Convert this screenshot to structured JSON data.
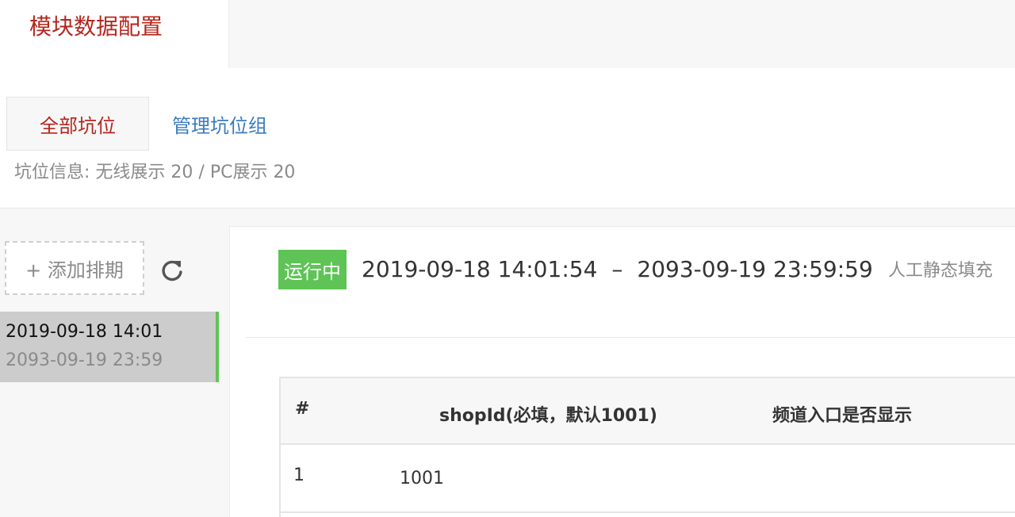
{
  "header": {
    "module_title": "模块数据配置"
  },
  "tabs": [
    {
      "label": "全部坑位",
      "active": true
    },
    {
      "label": "管理坑位组",
      "active": false
    }
  ],
  "slot_info": {
    "label": "坑位信息: ",
    "wireless_label": "无线展示 ",
    "wireless_count": "20",
    "separator": " / ",
    "pc_label": "PC展示 ",
    "pc_count": "20"
  },
  "sidebar": {
    "add_button": "+ 添加排期",
    "refresh_icon": "refresh-icon",
    "schedules": [
      {
        "start": "2019-09-18 14:01",
        "end": "2093-09-19 23:59",
        "selected": true
      }
    ]
  },
  "detail": {
    "status": "运行中",
    "start": "2019-09-18 14:01:54",
    "dash": "–",
    "end": "2093-09-19 23:59:59",
    "fill_type": "人工静态填充"
  },
  "table": {
    "headers": [
      "#",
      "shopId(必填，默认1001)",
      "频道入口是否显示"
    ],
    "rows": [
      [
        "1",
        "1001",
        ""
      ]
    ]
  },
  "colors": {
    "accent_red": "#b3261e",
    "link_blue": "#3a7bbf",
    "status_green": "#5ec455"
  }
}
